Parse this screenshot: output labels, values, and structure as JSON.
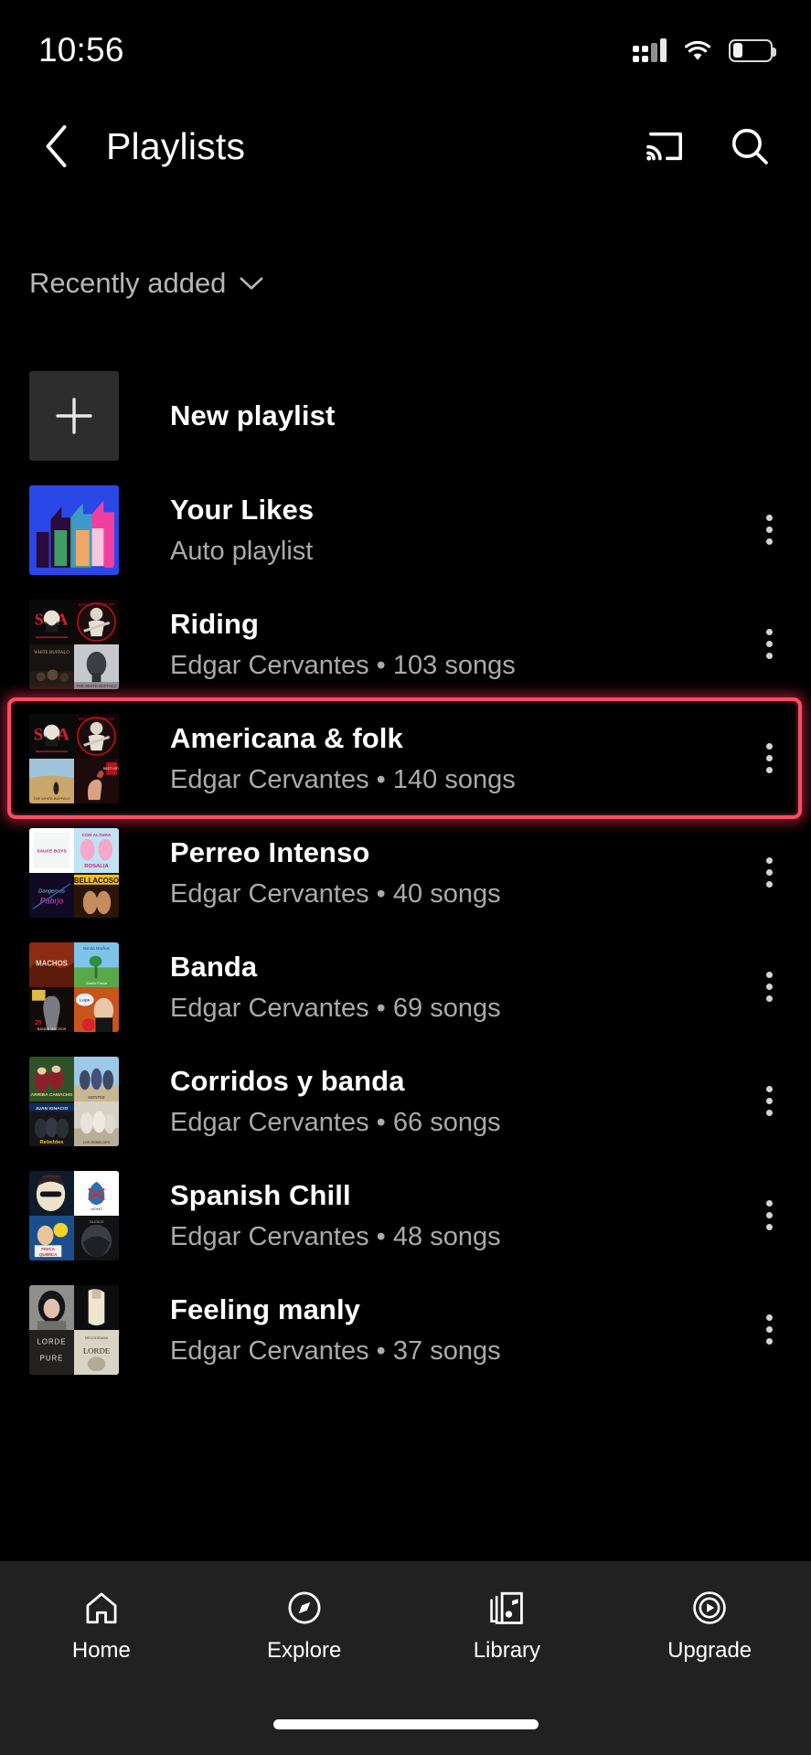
{
  "status_bar": {
    "time": "10:56",
    "icons": [
      "cell-signal-icon",
      "wifi-icon",
      "battery-icon"
    ],
    "battery_level_pct": 26
  },
  "app_bar": {
    "back_icon": "chevron-left-icon",
    "title": "Playlists",
    "actions": [
      {
        "name": "cast-icon",
        "label": "Cast"
      },
      {
        "name": "search-icon",
        "label": "Search"
      }
    ]
  },
  "sort": {
    "label": "Recently added",
    "chevron_icon": "chevron-down-icon"
  },
  "list": {
    "new_playlist": {
      "label": "New playlist",
      "icon": "plus-icon"
    },
    "items": [
      {
        "title": "Your Likes",
        "subtitle": "Auto playlist",
        "owner": "",
        "songs": "",
        "thumb": "likes",
        "menu_icon": "more-vertical-icon",
        "highlighted": false
      },
      {
        "title": "Riding",
        "subtitle": "Edgar Cervantes • 103 songs",
        "owner": "Edgar Cervantes",
        "songs": "103 songs",
        "thumb": "riding",
        "menu_icon": "more-vertical-icon",
        "highlighted": false
      },
      {
        "title": "Americana & folk",
        "subtitle": "Edgar Cervantes • 140 songs",
        "owner": "Edgar Cervantes",
        "songs": "140 songs",
        "thumb": "americana",
        "menu_icon": "more-vertical-icon",
        "highlighted": true
      },
      {
        "title": "Perreo Intenso",
        "subtitle": "Edgar Cervantes • 40 songs",
        "owner": "Edgar Cervantes",
        "songs": "40 songs",
        "thumb": "perreo",
        "menu_icon": "more-vertical-icon",
        "highlighted": false
      },
      {
        "title": "Banda",
        "subtitle": "Edgar Cervantes • 69 songs",
        "owner": "Edgar Cervantes",
        "songs": "69 songs",
        "thumb": "banda",
        "menu_icon": "more-vertical-icon",
        "highlighted": false
      },
      {
        "title": "Corridos y banda",
        "subtitle": "Edgar Cervantes • 66 songs",
        "owner": "Edgar Cervantes",
        "songs": "66 songs",
        "thumb": "corridos",
        "menu_icon": "more-vertical-icon",
        "highlighted": false
      },
      {
        "title": "Spanish Chill",
        "subtitle": "Edgar Cervantes • 48 songs",
        "owner": "Edgar Cervantes",
        "songs": "48 songs",
        "thumb": "spanish",
        "menu_icon": "more-vertical-icon",
        "highlighted": false
      },
      {
        "title": "Feeling manly",
        "subtitle": "Edgar Cervantes • 37 songs",
        "owner": "Edgar Cervantes",
        "songs": "37 songs",
        "thumb": "manly",
        "menu_icon": "more-vertical-icon",
        "highlighted": false
      }
    ]
  },
  "bottom_nav": {
    "items": [
      {
        "label": "Home",
        "icon": "home-icon",
        "active": false
      },
      {
        "label": "Explore",
        "icon": "compass-icon",
        "active": false
      },
      {
        "label": "Library",
        "icon": "library-music-icon",
        "active": true
      },
      {
        "label": "Upgrade",
        "icon": "play-circle-icon",
        "active": false
      }
    ]
  },
  "colors": {
    "background": "#000000",
    "surface": "#212121",
    "text_primary": "#ffffff",
    "text_secondary": "#aaaaaa",
    "highlight_ring": "#ff4d5e",
    "likes_thumb_blue": "#2a47e8"
  }
}
